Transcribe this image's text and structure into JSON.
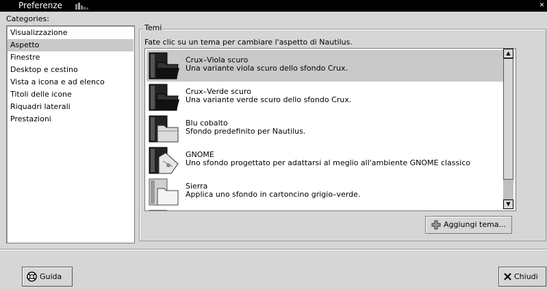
{
  "window": {
    "title": "Preferenze"
  },
  "categories": {
    "label": "Categories:",
    "items": [
      {
        "label": "Visualizzazione"
      },
      {
        "label": "Aspetto"
      },
      {
        "label": "Finestre"
      },
      {
        "label": "Desktop e cestino"
      },
      {
        "label": "Vista a icona e ad elenco"
      },
      {
        "label": "Titoli delle icone"
      },
      {
        "label": "Riquadri laterali"
      },
      {
        "label": "Prestazioni"
      }
    ],
    "selected": "Aspetto"
  },
  "themes": {
    "frame_label": "Temi",
    "description": "Fate clic su un tema per cambiare l'aspetto di Nautilus.",
    "items": [
      {
        "name": "Crux–Viola scuro",
        "desc": "Una variante viola scuro dello sfondo Crux.",
        "icon": "dark-folder-icon"
      },
      {
        "name": "Crux–Verde scuro",
        "desc": "Una variante verde scuro dello sfondo Crux.",
        "icon": "dark-folder-icon"
      },
      {
        "name": "Blu cobalto",
        "desc": "Sfondo predefinito per Nautilus.",
        "icon": "light-folder-icon"
      },
      {
        "name": "GNOME",
        "desc": "Uno sfondo progettato per adattarsi al meglio all'ambiente GNOME classico",
        "icon": "gnome-folder-icon"
      },
      {
        "name": "Sierra",
        "desc": "Applica uno sfondo in cartoncino grigio–verde.",
        "icon": "white-folder-icon"
      }
    ],
    "selected": "Crux–Viola scuro",
    "add_button": "Aggiungi tema..."
  },
  "buttons": {
    "help": "Guida",
    "close": "Chiudi"
  }
}
